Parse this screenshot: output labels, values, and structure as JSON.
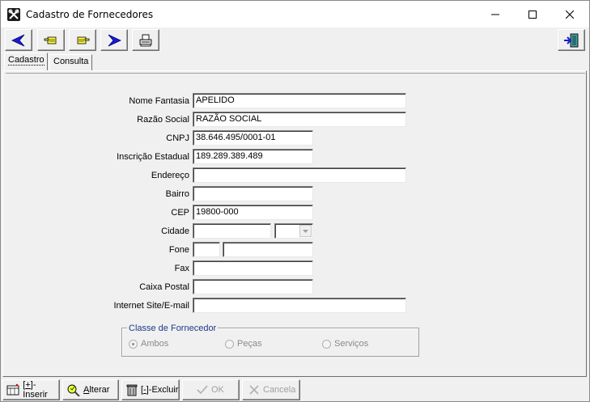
{
  "window": {
    "title": "Cadastro de Fornecedores"
  },
  "toolbar": {
    "buttons": [
      {
        "name": "first-record",
        "icon": "arrow-left-icon"
      },
      {
        "name": "previous-record",
        "icon": "hand-left-icon"
      },
      {
        "name": "next-record",
        "icon": "hand-right-icon"
      },
      {
        "name": "last-record",
        "icon": "arrow-right-icon"
      },
      {
        "name": "print",
        "icon": "printer-icon"
      }
    ],
    "exit_icon": "exit-door-icon"
  },
  "tabs": [
    {
      "label": "Cadastro",
      "active": true
    },
    {
      "label": "Consulta",
      "active": false
    }
  ],
  "form": {
    "nome_fantasia": {
      "label": "Nome Fantasia",
      "value": "APELIDO"
    },
    "razao_social": {
      "label": "Razão Social",
      "value": "RAZÃO SOCIAL"
    },
    "cnpj": {
      "label": "CNPJ",
      "value": "38.646.495/0001-01"
    },
    "inscricao_estadual": {
      "label": "Inscrição Estadual",
      "value": "189.289.389.489"
    },
    "endereco": {
      "label": "Endereço",
      "value": ""
    },
    "bairro": {
      "label": "Bairro",
      "value": ""
    },
    "cep": {
      "label": "CEP",
      "value": "19800-000"
    },
    "cidade": {
      "label": "Cidade",
      "value": "",
      "uf": ""
    },
    "fone": {
      "label": "Fone",
      "ddd": "",
      "value": ""
    },
    "fax": {
      "label": "Fax",
      "value": ""
    },
    "caixa_postal": {
      "label": "Caixa Postal",
      "value": ""
    },
    "site_email": {
      "label": "Internet Site/E-mail",
      "value": ""
    }
  },
  "classe": {
    "title": "Classe de Fornecedor",
    "options": [
      {
        "label": "Ambos",
        "selected": true
      },
      {
        "label": "Peças",
        "selected": false
      },
      {
        "label": "Serviços",
        "selected": false
      }
    ]
  },
  "actions": {
    "inserir_pre": "[",
    "inserir_key": "+",
    "inserir_post": "]-Inserir",
    "alterar_key": "A",
    "alterar_post": "lterar",
    "excluir_pre": "[",
    "excluir_key": "-",
    "excluir_post": "]-Excluir",
    "ok": "OK",
    "cancela": "Cancela"
  },
  "colors": {
    "accent_blue": "#1a1ad0",
    "group_title": "#1a3a8a",
    "disabled": "#a0a0a0"
  }
}
